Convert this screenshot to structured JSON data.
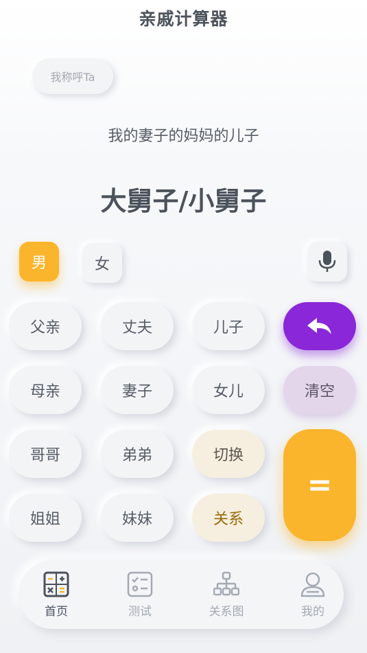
{
  "header": {
    "title": "亲戚计算器"
  },
  "call_chip": {
    "label": "我称呼Ta"
  },
  "display": {
    "expression": "我的妻子的妈妈的儿子",
    "result": "大舅子/小舅子"
  },
  "gender": {
    "male": "男",
    "female": "女",
    "selected": "男"
  },
  "keys": {
    "father": "父亲",
    "husband": "丈夫",
    "son": "儿子",
    "mother": "母亲",
    "wife": "妻子",
    "daughter": "女儿",
    "clear": "清空",
    "elder_brother": "哥哥",
    "younger_brother": "弟弟",
    "switch": "切换",
    "elder_sister": "姐姐",
    "younger_sister": "妹妹",
    "relation": "关系",
    "equals": "="
  },
  "tabs": [
    {
      "label": "首页",
      "icon": "calculator-icon",
      "active": true
    },
    {
      "label": "测试",
      "icon": "checklist-icon",
      "active": false
    },
    {
      "label": "关系图",
      "icon": "hierarchy-icon",
      "active": false
    },
    {
      "label": "我的",
      "icon": "person-icon",
      "active": false
    }
  ],
  "colors": {
    "accent": "#fbb52c",
    "undo": "#8a27d8",
    "clear": "#e3d6ea"
  }
}
